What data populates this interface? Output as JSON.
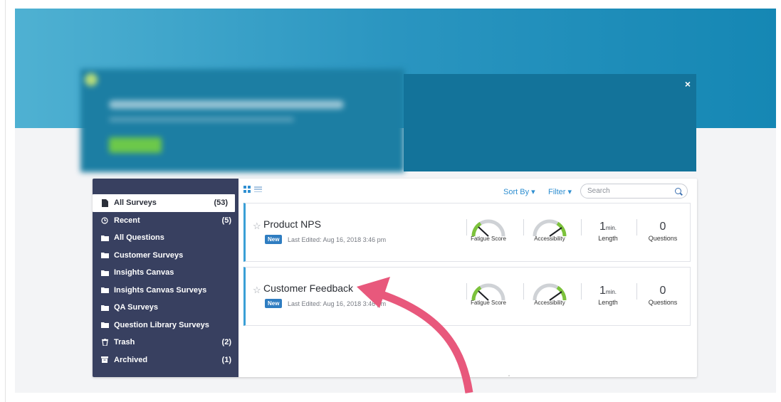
{
  "promo": {
    "close_label": "×"
  },
  "sidebar": {
    "items": [
      {
        "label": "All Surveys",
        "count": "(53)",
        "icon": "document-icon",
        "active": true
      },
      {
        "label": "Recent",
        "count": "(5)",
        "icon": "clock-icon",
        "active": false
      },
      {
        "label": "All Questions",
        "count": "",
        "icon": "folder-icon",
        "active": false
      },
      {
        "label": "Customer Surveys",
        "count": "",
        "icon": "folder-icon",
        "active": false
      },
      {
        "label": "Insights Canvas",
        "count": "",
        "icon": "folder-icon",
        "active": false
      },
      {
        "label": "Insights Canvas Surveys",
        "count": "",
        "icon": "folder-icon",
        "active": false
      },
      {
        "label": "QA Surveys",
        "count": "",
        "icon": "folder-icon",
        "active": false
      },
      {
        "label": "Question Library Surveys",
        "count": "",
        "icon": "folder-icon",
        "active": false
      },
      {
        "label": "Trash",
        "count": "(2)",
        "icon": "trash-icon",
        "active": false
      },
      {
        "label": "Archived",
        "count": "(1)",
        "icon": "archive-icon",
        "active": false
      }
    ]
  },
  "toolbar": {
    "sort_label": "Sort By ▾",
    "filter_label": "Filter ▾",
    "search_placeholder": "Search"
  },
  "surveys": [
    {
      "title": "Product NPS",
      "badge": "New",
      "last_edited": "Last Edited: Aug 16, 2018 3:46 pm",
      "fatigue_label": "Fatigue Score",
      "accessibility_label": "Accessibility",
      "length_value": "1",
      "length_unit": "min.",
      "length_label": "Length",
      "questions_value": "0",
      "questions_label": "Questions"
    },
    {
      "title": "Customer Feedback",
      "badge": "New",
      "last_edited": "Last Edited: Aug 16, 2018 3:46 pm",
      "fatigue_label": "Fatigue Score",
      "accessibility_label": "Accessibility",
      "length_value": "1",
      "length_unit": "min.",
      "length_label": "Length",
      "questions_value": "0",
      "questions_label": "Questions"
    }
  ],
  "colors": {
    "hero": "#2a95c0",
    "promo_panel": "#13739a",
    "sidebar": "#384060",
    "accent": "#2f8fd1",
    "gauge_green": "#7cc23b",
    "arrow": "#e8587c"
  }
}
